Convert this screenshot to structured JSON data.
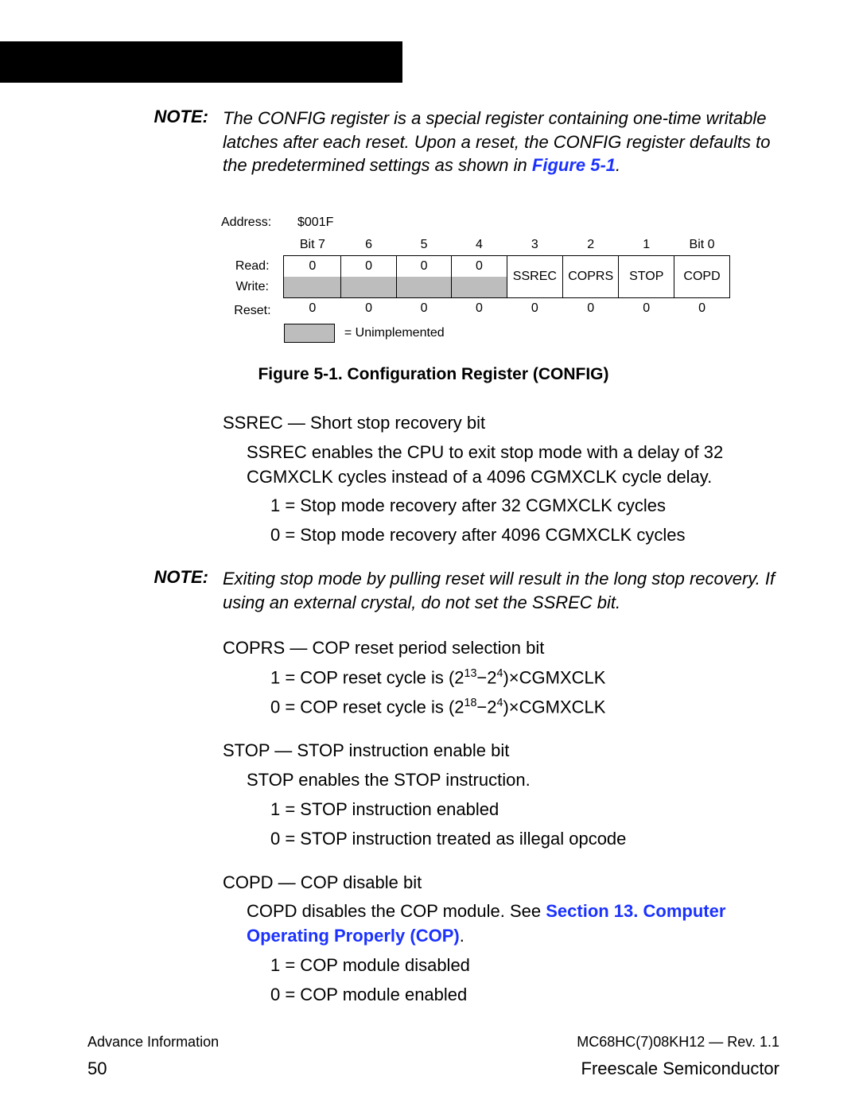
{
  "note1": {
    "label": "NOTE:",
    "text_a": "The CONFIG register is a special register containing one-time writable latches after each reset. Upon a reset, the CONFIG register defaults to the predetermined settings as shown in ",
    "link": "Figure 5-1",
    "text_b": "."
  },
  "register": {
    "address_label": "Address:",
    "address_value": "$001F",
    "bit_headers": [
      "Bit 7",
      "6",
      "5",
      "4",
      "3",
      "2",
      "1",
      "Bit 0"
    ],
    "read_label": "Read:",
    "write_label": "Write:",
    "reset_label": "Reset:",
    "read": [
      "0",
      "0",
      "0",
      "0"
    ],
    "named": [
      "SSREC",
      "COPRS",
      "STOP",
      "COPD"
    ],
    "reset": [
      "0",
      "0",
      "0",
      "0",
      "0",
      "0",
      "0",
      "0"
    ],
    "legend": "= Unimplemented",
    "caption": "Figure 5-1. Configuration Register (CONFIG)"
  },
  "ssrec": {
    "title": "SSREC — Short stop recovery bit",
    "desc": "SSREC enables the CPU to exit stop mode with a delay of 32 CGMXCLK cycles instead of a 4096 CGMXCLK cycle delay.",
    "v1": "1 = Stop mode recovery after 32 CGMXCLK cycles",
    "v0": "0 = Stop mode recovery after 4096 CGMXCLK cycles"
  },
  "note2": {
    "label": "NOTE:",
    "text": "Exiting stop mode by pulling reset will result in the long stop recovery. If using an external crystal, do not set the SSREC bit."
  },
  "coprs": {
    "title": "COPRS — COP reset period selection bit",
    "v1_a": "1 = COP reset cycle is (2",
    "v1_b": "−2",
    "v1_c": ")×CGMXCLK",
    "e1a": "13",
    "e1b": "4",
    "v0_a": "0 = COP reset cycle is (2",
    "v0_b": "−2",
    "v0_c": ")×CGMXCLK",
    "e0a": "18",
    "e0b": "4"
  },
  "stop": {
    "title": "STOP — STOP instruction enable bit",
    "desc": "STOP enables the STOP instruction.",
    "v1": "1 = STOP instruction enabled",
    "v0": "0 = STOP instruction treated as illegal opcode"
  },
  "copd": {
    "title": "COPD — COP disable bit",
    "desc_a": "COPD disables the COP module. See ",
    "link": "Section 13. Computer Operating Properly (COP)",
    "desc_b": ".",
    "v1": "1 = COP module disabled",
    "v0": "0 = COP module enabled"
  },
  "footer": {
    "left1": "Advance Information",
    "right1": "MC68HC(7)08KH12 — Rev. 1.1",
    "page": "50",
    "right2": "Freescale Semiconductor"
  }
}
